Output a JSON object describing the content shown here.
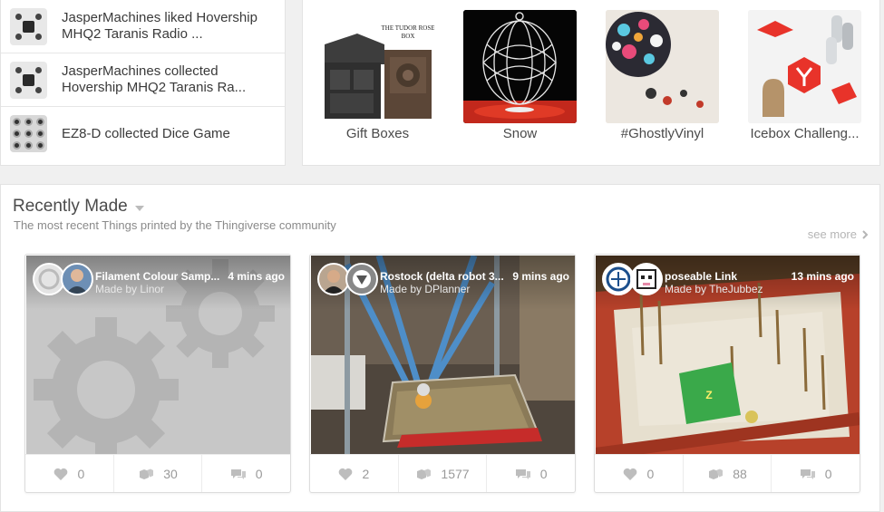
{
  "activity": [
    {
      "text": "JasperMachines liked Hovership MHQ2 Taranis Radio ...",
      "thumb_icon": "drone-thumb"
    },
    {
      "text": "JasperMachines collected Hovership MHQ2 Taranis Ra...",
      "thumb_icon": "drone-thumb"
    },
    {
      "text": "EZ8-D collected Dice Game",
      "thumb_icon": "dice-thumb"
    }
  ],
  "collections": [
    {
      "label": "Gift Boxes",
      "image_text": [
        "THE TUDOR ROSE",
        "BOX"
      ]
    },
    {
      "label": "Snow"
    },
    {
      "label": "#GhostlyVinyl"
    },
    {
      "label": "Icebox Challeng..."
    }
  ],
  "recent": {
    "title": "Recently Made",
    "subtitle": "The most recent Things printed by the Thingiverse community",
    "see_more": "see more",
    "cards": [
      {
        "title": "Filament Colour Samp...",
        "made_by": "Made by Linor",
        "time": "4 mins ago",
        "likes": "0",
        "makes": "30",
        "comments": "0"
      },
      {
        "title": "Rostock (delta robot 3...",
        "made_by": "Made by DPlanner",
        "time": "9 mins ago",
        "likes": "2",
        "makes": "1577",
        "comments": "0"
      },
      {
        "title": "poseable Link",
        "made_by": "Made by TheJubbez",
        "time": "13 mins ago",
        "likes": "0",
        "makes": "88",
        "comments": "0"
      }
    ]
  },
  "colors": {
    "stat_icon": "#bdbdbd",
    "placeholder_bg": "#c6c6c6",
    "gear": "#b3b3b3"
  }
}
